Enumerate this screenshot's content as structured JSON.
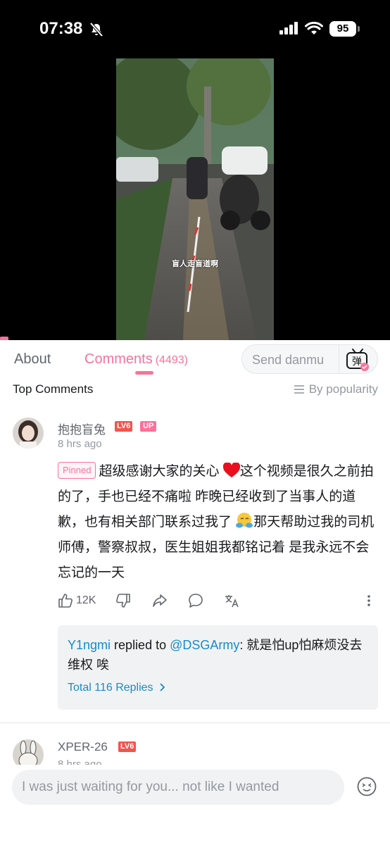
{
  "status_bar": {
    "time": "07:38",
    "battery": "95"
  },
  "video": {
    "caption": "盲人走盲道啊"
  },
  "tabs": {
    "about": "About",
    "comments": "Comments",
    "comments_count": "(4493)"
  },
  "danmu": {
    "placeholder": "Send danmu",
    "icon_label": "弹"
  },
  "comments_header": {
    "title": "Top Comments",
    "sort_label": "By popularity"
  },
  "pinned_comment": {
    "username": "抱抱盲兔",
    "level_badge": "LV6",
    "up_badge": "UP",
    "time": "8 hrs ago",
    "pinned_label": "Pinned",
    "text_part1": "超级感谢大家的关心",
    "text_part2": "这个视频是很久之前拍的了，手也已经不痛啦 昨晚已经收到了当事人的道歉，也有相关部门联系过我了",
    "text_part3": "那天帮助过我的司机师傅，警察叔叔，医生姐姐我都铭记着 是我永远不会忘记的一天",
    "likes": "12K",
    "reply": {
      "user": "Y1ngmi",
      "replied_to": "replied to",
      "target": "@DSGArmy",
      "text": ": 就是怕up怕麻烦没去维权 唉",
      "total": "Total 116 Replies"
    }
  },
  "second_comment": {
    "username": "XPER-26",
    "level_badge": "LV6",
    "time": "8 hrs ago"
  },
  "input": {
    "placeholder": "I was just waiting for you... not like I wanted"
  },
  "colors": {
    "accent": "#fb7299",
    "link": "#178bcf",
    "level": "#f2554b"
  }
}
